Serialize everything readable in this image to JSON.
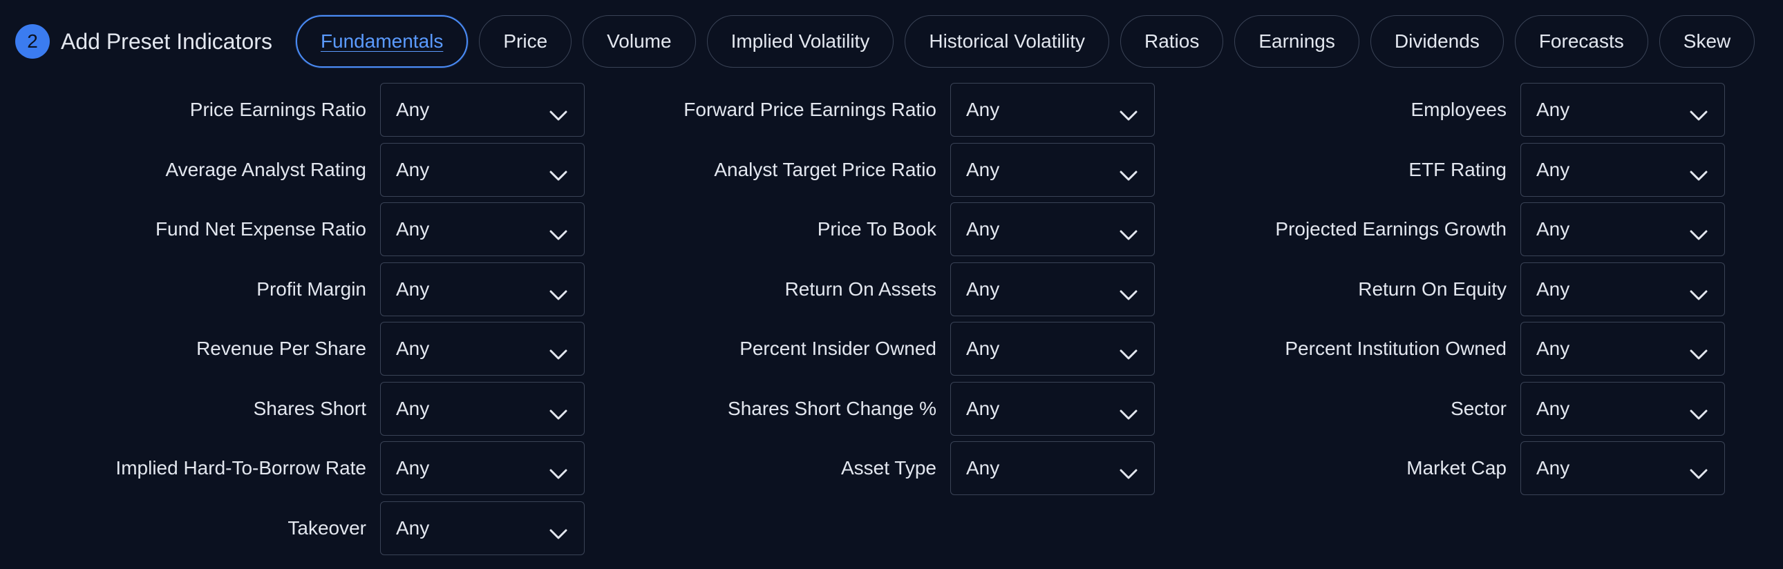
{
  "header": {
    "step": "2",
    "title": "Add Preset Indicators"
  },
  "tabs": [
    {
      "label": "Fundamentals",
      "active": true
    },
    {
      "label": "Price",
      "active": false
    },
    {
      "label": "Volume",
      "active": false
    },
    {
      "label": "Implied Volatility",
      "active": false
    },
    {
      "label": "Historical Volatility",
      "active": false
    },
    {
      "label": "Ratios",
      "active": false
    },
    {
      "label": "Earnings",
      "active": false
    },
    {
      "label": "Dividends",
      "active": false
    },
    {
      "label": "Forecasts",
      "active": false
    },
    {
      "label": "Skew",
      "active": false
    }
  ],
  "colors": {
    "background": "#0b1120",
    "accent": "#4b8df8",
    "border": "#3a4356",
    "text": "#e3e7ef"
  },
  "columns": [
    {
      "items": [
        {
          "label": "Price Earnings Ratio",
          "value": "Any"
        },
        {
          "label": "Average Analyst Rating",
          "value": "Any"
        },
        {
          "label": "Fund Net Expense Ratio",
          "value": "Any"
        },
        {
          "label": "Profit Margin",
          "value": "Any"
        },
        {
          "label": "Revenue Per Share",
          "value": "Any"
        },
        {
          "label": "Shares Short",
          "value": "Any"
        },
        {
          "label": "Implied Hard-To-Borrow Rate",
          "value": "Any"
        },
        {
          "label": "Takeover",
          "value": "Any"
        }
      ]
    },
    {
      "items": [
        {
          "label": "Forward Price Earnings Ratio",
          "value": "Any"
        },
        {
          "label": "Analyst Target Price Ratio",
          "value": "Any"
        },
        {
          "label": "Price To Book",
          "value": "Any"
        },
        {
          "label": "Return On Assets",
          "value": "Any"
        },
        {
          "label": "Percent Insider Owned",
          "value": "Any"
        },
        {
          "label": "Shares Short Change %",
          "value": "Any"
        },
        {
          "label": "Asset Type",
          "value": "Any"
        }
      ]
    },
    {
      "items": [
        {
          "label": "Employees",
          "value": "Any"
        },
        {
          "label": "ETF Rating",
          "value": "Any"
        },
        {
          "label": "Projected Earnings Growth",
          "value": "Any"
        },
        {
          "label": "Return On Equity",
          "value": "Any"
        },
        {
          "label": "Percent Institution Owned",
          "value": "Any"
        },
        {
          "label": "Sector",
          "value": "Any"
        },
        {
          "label": "Market Cap",
          "value": "Any"
        }
      ]
    }
  ]
}
